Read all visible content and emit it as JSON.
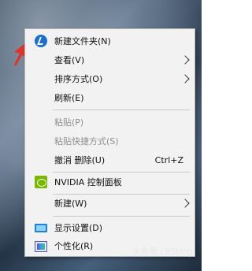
{
  "menu": {
    "items": [
      {
        "label": "新建文件夹(N)",
        "icon": "new-folder-icon"
      },
      {
        "label": "查看(V)",
        "submenu": true
      },
      {
        "label": "排序方式(O)",
        "submenu": true
      },
      {
        "label": "刷新(E)"
      },
      {
        "label": "粘贴(P)",
        "disabled": true
      },
      {
        "label": "粘贴快捷方式(S)",
        "disabled": true
      },
      {
        "label": "撤消 删除(U)",
        "shortcut": "Ctrl+Z"
      },
      {
        "label": "NVIDIA 控制面板",
        "icon": "nvidia-icon"
      },
      {
        "label": "新建(W)",
        "submenu": true
      },
      {
        "label": "显示设置(D)",
        "icon": "display-icon"
      },
      {
        "label": "个性化(R)",
        "icon": "personalize-icon"
      }
    ]
  },
  "watermark": "头条号 / 9Sblog",
  "colors": {
    "accent_arrow": "#e0332c",
    "nvidia": "#76b900",
    "menu_bg": "#f2f2f2"
  }
}
